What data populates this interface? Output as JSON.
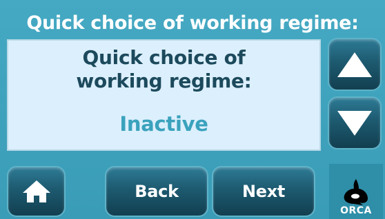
{
  "header": {
    "title": "Quick choice of working regime:"
  },
  "panel": {
    "title_line1": "Quick choice of",
    "title_line2": "working regime:",
    "value": "Inactive"
  },
  "footer": {
    "back_label": "Back",
    "next_label": "Next",
    "logo_text": "ORCA"
  },
  "icons": {
    "up": "arrow-up-icon",
    "down": "arrow-down-icon",
    "home": "home-icon",
    "logo": "orca-whale-logo"
  },
  "colors": {
    "background": "#3a9fba",
    "panel": "#dceffd",
    "button": "#1d5a70",
    "value_text": "#3aa2bd"
  }
}
